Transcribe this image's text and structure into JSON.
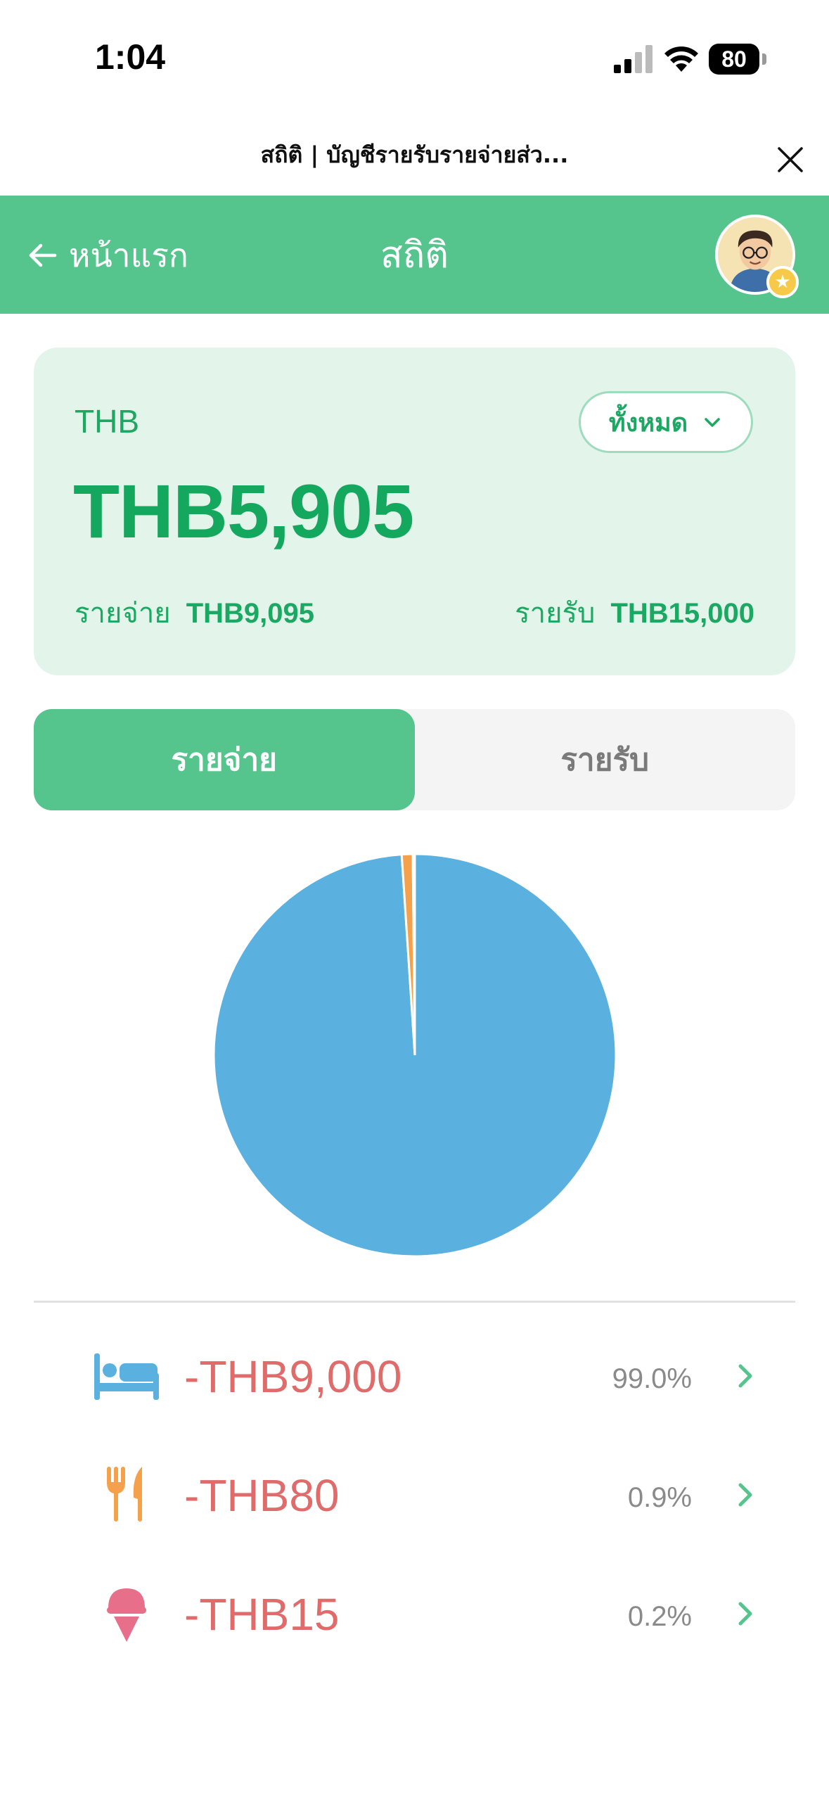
{
  "status": {
    "time": "1:04",
    "battery": "80"
  },
  "browser": {
    "title": "สถิติ | บัญชีรายรับรายจ่ายส่ว..."
  },
  "header": {
    "back_label": "หน้าแรก",
    "title": "สถิติ"
  },
  "summary": {
    "currency": "THB",
    "filter_label": "ทั้งหมด",
    "balance": "THB5,905",
    "expense_label": "รายจ่าย",
    "expense_value": "THB9,095",
    "income_label": "รายรับ",
    "income_value": "THB15,000"
  },
  "tabs": [
    {
      "label": "รายจ่าย",
      "active": true
    },
    {
      "label": "รายรับ",
      "active": false
    }
  ],
  "chart_data": {
    "type": "pie",
    "slices": [
      {
        "category": "accommodation",
        "value": 9000,
        "percent": 99.0,
        "color": "#5ab1df"
      },
      {
        "category": "food",
        "value": 80,
        "percent": 0.9,
        "color": "#f5a04a"
      },
      {
        "category": "snack",
        "value": 15,
        "percent": 0.2,
        "color": "#e86f8a"
      }
    ]
  },
  "categories": [
    {
      "icon": "bed-icon",
      "amount": "-THB9,000",
      "percent": "99.0%",
      "color": "#5ab1df"
    },
    {
      "icon": "utensils-icon",
      "amount": "-THB80",
      "percent": "0.9%",
      "color": "#f5a04a"
    },
    {
      "icon": "ice-cream-icon",
      "amount": "-THB15",
      "percent": "0.2%",
      "color": "#e86f8a"
    }
  ],
  "colors": {
    "brand_green": "#55c58d",
    "expense_red": "#e06b6b"
  }
}
